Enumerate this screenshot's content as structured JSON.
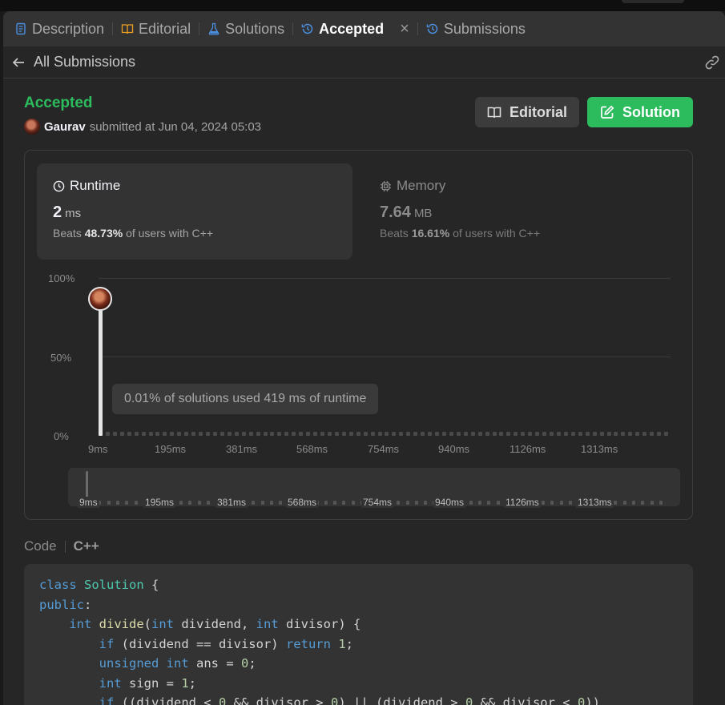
{
  "tabs": [
    {
      "label": "Description",
      "icon": "description-icon"
    },
    {
      "label": "Editorial",
      "icon": "book-icon"
    },
    {
      "label": "Solutions",
      "icon": "flask-icon"
    },
    {
      "label": "Accepted",
      "icon": "history-icon",
      "active": true
    },
    {
      "label": "Submissions",
      "icon": "history-icon"
    }
  ],
  "header": {
    "back_label": "All Submissions"
  },
  "submission": {
    "status": "Accepted",
    "user": "Gaurav",
    "submitted_text": "submitted at Jun 04, 2024 05:03"
  },
  "buttons": {
    "editorial": "Editorial",
    "solution": "Solution"
  },
  "runtime": {
    "label": "Runtime",
    "value": "2",
    "unit": "ms",
    "beats_prefix": "Beats",
    "beats_pct": "48.73%",
    "beats_suffix": "of users with C++"
  },
  "memory": {
    "label": "Memory",
    "value": "7.64",
    "unit": "MB",
    "beats_prefix": "Beats",
    "beats_pct": "16.61%",
    "beats_suffix": "of users with C++"
  },
  "chart_data": {
    "type": "bar",
    "ylim": [
      0,
      100
    ],
    "yticks": [
      "100%",
      "50%",
      "0%"
    ],
    "xticks": [
      "9ms",
      "195ms",
      "381ms",
      "568ms",
      "754ms",
      "940ms",
      "1126ms",
      "1313ms"
    ],
    "selected_value_pct": 92,
    "tooltip": "0.01% of solutions used 419 ms of runtime"
  },
  "code_section": {
    "label": "Code",
    "language": "C++"
  },
  "colors": {
    "accent_green": "#2cbb5d",
    "keyword": "#569cd6",
    "type": "#4ec9b0"
  }
}
